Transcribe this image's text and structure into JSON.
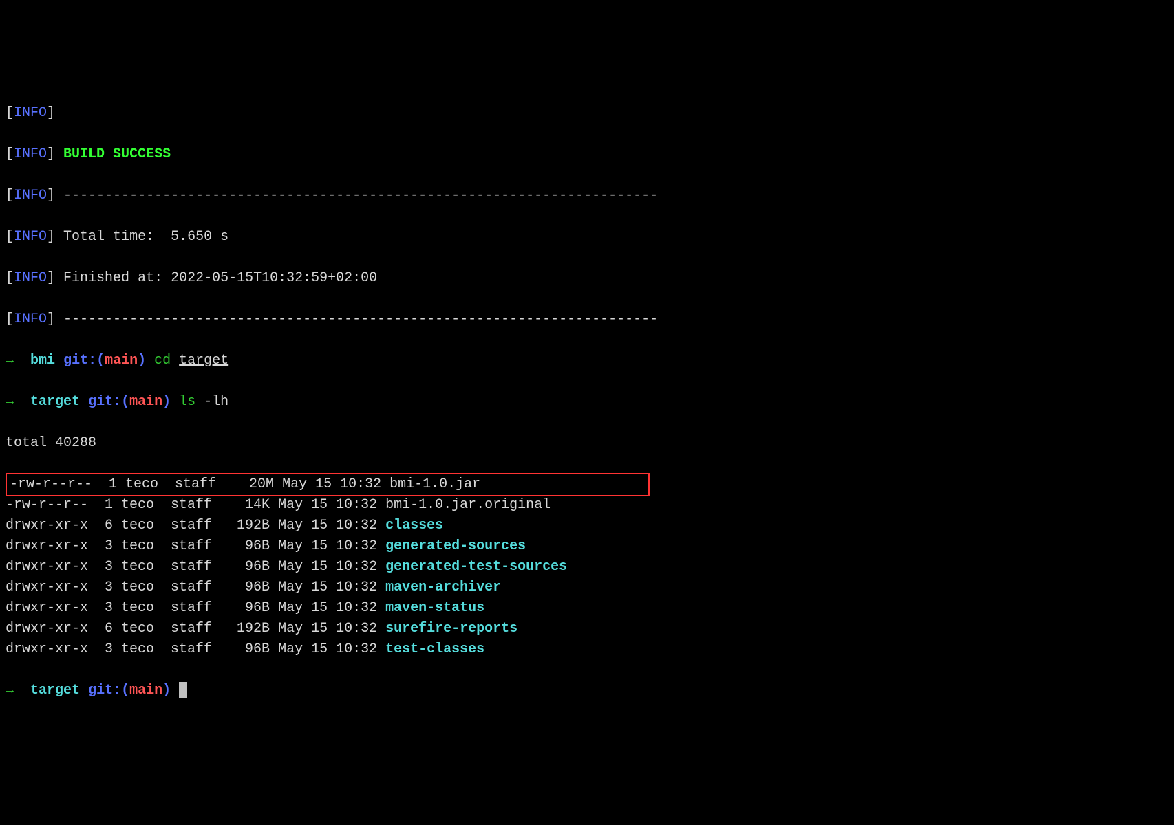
{
  "info_label": "INFO",
  "build_success": "BUILD SUCCESS",
  "dashes": "------------------------------------------------------------------------",
  "total_time_label": "Total time:  ",
  "total_time_value": "5.650 s",
  "finished_label": "Finished at: ",
  "finished_value": "2022-05-15T10:32:59+02:00",
  "prompt_arrow": "→",
  "prompt1_dir": "bmi",
  "git_prefix": "git:(",
  "git_branch": "main",
  "git_suffix": ")",
  "cmd_cd": "cd",
  "cd_arg": "target",
  "prompt2_dir": "target",
  "cmd_ls": "ls",
  "ls_arg": "-lh",
  "ls_total": "total 40288",
  "files": [
    {
      "perms": "-rw-r--r--",
      "links": "1",
      "user": "teco",
      "group": "staff",
      "size": " 20M",
      "date": "May 15 10:32",
      "name": "bmi-1.0.jar",
      "dir": false,
      "highlight": true
    },
    {
      "perms": "-rw-r--r--",
      "links": "1",
      "user": "teco",
      "group": "staff",
      "size": " 14K",
      "date": "May 15 10:32",
      "name": "bmi-1.0.jar.original",
      "dir": false,
      "highlight": false
    },
    {
      "perms": "drwxr-xr-x",
      "links": "6",
      "user": "teco",
      "group": "staff",
      "size": "192B",
      "date": "May 15 10:32",
      "name": "classes",
      "dir": true,
      "highlight": false
    },
    {
      "perms": "drwxr-xr-x",
      "links": "3",
      "user": "teco",
      "group": "staff",
      "size": " 96B",
      "date": "May 15 10:32",
      "name": "generated-sources",
      "dir": true,
      "highlight": false
    },
    {
      "perms": "drwxr-xr-x",
      "links": "3",
      "user": "teco",
      "group": "staff",
      "size": " 96B",
      "date": "May 15 10:32",
      "name": "generated-test-sources",
      "dir": true,
      "highlight": false
    },
    {
      "perms": "drwxr-xr-x",
      "links": "3",
      "user": "teco",
      "group": "staff",
      "size": " 96B",
      "date": "May 15 10:32",
      "name": "maven-archiver",
      "dir": true,
      "highlight": false
    },
    {
      "perms": "drwxr-xr-x",
      "links": "3",
      "user": "teco",
      "group": "staff",
      "size": " 96B",
      "date": "May 15 10:32",
      "name": "maven-status",
      "dir": true,
      "highlight": false
    },
    {
      "perms": "drwxr-xr-x",
      "links": "6",
      "user": "teco",
      "group": "staff",
      "size": "192B",
      "date": "May 15 10:32",
      "name": "surefire-reports",
      "dir": true,
      "highlight": false
    },
    {
      "perms": "drwxr-xr-x",
      "links": "3",
      "user": "teco",
      "group": "staff",
      "size": " 96B",
      "date": "May 15 10:32",
      "name": "test-classes",
      "dir": true,
      "highlight": false
    }
  ]
}
